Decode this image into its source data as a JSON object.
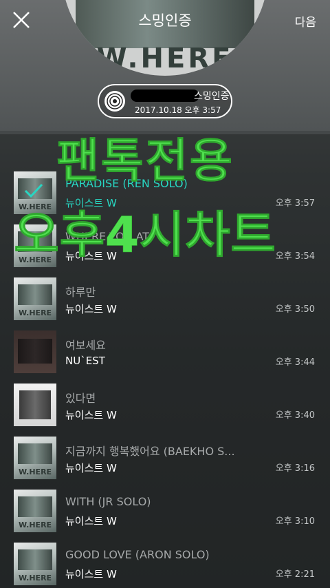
{
  "header": {
    "title": "스밍인증",
    "next_label": "다음",
    "album_letters": "W.HERE"
  },
  "badge": {
    "title": "스밍인증",
    "date": "2017.10.18 오후 3:57"
  },
  "overlay": {
    "line1": "팬톡전용",
    "line2": "오후4시차트"
  },
  "list": {
    "faint_header": "",
    "items": [
      {
        "title": "PARADISE (REN SOLO)",
        "artist": "뉴이스트 W",
        "time": "오후 3:57",
        "thumb": "W.HERE",
        "active": true
      },
      {
        "title": "WHERE YOU AT",
        "artist": "뉴이스트 W",
        "time": "오후 3:54",
        "thumb": "W.HERE",
        "active": false
      },
      {
        "title": "하루만",
        "artist": "뉴이스트 W",
        "time": "오후 3:50",
        "thumb": "W.HERE",
        "active": false
      },
      {
        "title": "여보세요",
        "artist": "NU`EST",
        "time": "오후 3:44",
        "thumb": "",
        "active": false
      },
      {
        "title": "있다면",
        "artist": "뉴이스트 W",
        "time": "오후 3:40",
        "thumb": "",
        "active": false
      },
      {
        "title": "지금까지 행복했어요 (BAEKHO S...",
        "artist": "뉴이스트 W",
        "time": "오후 3:16",
        "thumb": "W.HERE",
        "active": false
      },
      {
        "title": "WITH (JR SOLO)",
        "artist": "뉴이스트 W",
        "time": "오후 3:10",
        "thumb": "W.HERE",
        "active": false
      },
      {
        "title": "GOOD LOVE (ARON SOLO)",
        "artist": "뉴이스트 W",
        "time": "오후 2:21",
        "thumb": "W.HERE",
        "active": false
      }
    ]
  },
  "colors": {
    "accent": "#28d6c2",
    "overlay_green": "#4fe04e"
  }
}
